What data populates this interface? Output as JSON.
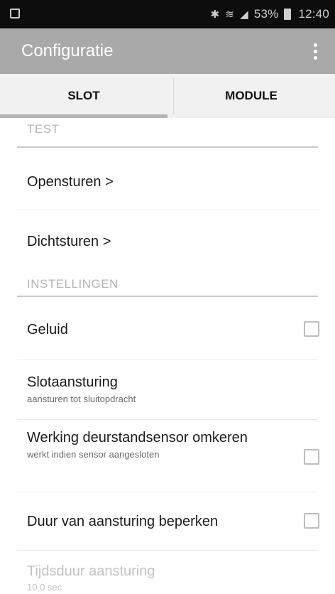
{
  "status_bar": {
    "battery": "53%",
    "time": "12:40",
    "icons": [
      "screenshot-icon",
      "bluetooth-icon",
      "wifi-icon",
      "signal-icon",
      "battery-icon"
    ]
  },
  "app_bar": {
    "title": "Configuratie"
  },
  "tabs": [
    {
      "label": "SLOT",
      "active": true
    },
    {
      "label": "MODULE",
      "active": false
    }
  ],
  "sections": {
    "test": {
      "header": "TEST",
      "items": [
        {
          "title": "Opensturen >"
        },
        {
          "title": "Dichtsturen >"
        }
      ]
    },
    "instellingen": {
      "header": "INSTELLINGEN",
      "items": [
        {
          "title": "Geluid",
          "checked": false
        },
        {
          "title": "Slotaansturing",
          "subtitle": "aansturen tot sluitopdracht"
        },
        {
          "title": "Werking deurstandsensor omkeren",
          "subtitle": "werkt indien sensor aangesloten",
          "checked": false
        },
        {
          "title": "Duur van aansturing beperken",
          "checked": false
        },
        {
          "title": "Tijdsduur aansturing",
          "subtitle": "10.0 sec",
          "enabled": false
        }
      ]
    }
  }
}
